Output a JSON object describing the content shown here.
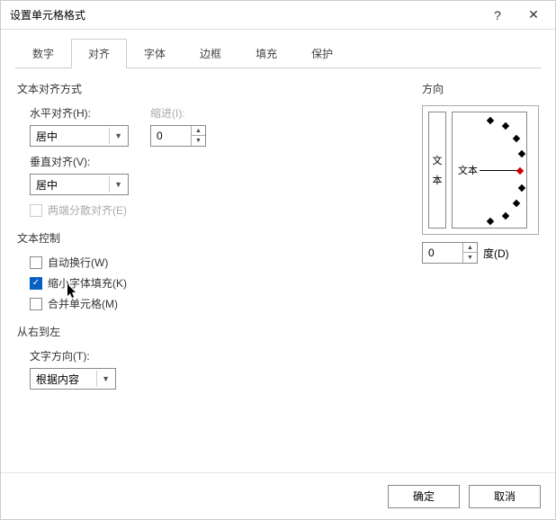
{
  "title": "设置单元格格式",
  "titlebar": {
    "help": "?",
    "close": "✕"
  },
  "tabs": [
    "数字",
    "对齐",
    "字体",
    "边框",
    "填充",
    "保护"
  ],
  "active_tab": 1,
  "align": {
    "group_title": "文本对齐方式",
    "horizontal_label": "水平对齐(H):",
    "horizontal_value": "居中",
    "vertical_label": "垂直对齐(V):",
    "vertical_value": "居中",
    "indent_label": "缩进(I):",
    "indent_value": "0",
    "justify_distributed_label": "两端分散对齐(E)",
    "justify_distributed_checked": false
  },
  "text_control": {
    "group_title": "文本控制",
    "wrap_label": "自动换行(W)",
    "wrap_checked": false,
    "shrink_label": "缩小字体填充(K)",
    "shrink_checked": true,
    "merge_label": "合并单元格(M)",
    "merge_checked": false
  },
  "rtl": {
    "group_title": "从右到左",
    "dir_label": "文字方向(T):",
    "dir_value": "根据内容"
  },
  "orientation": {
    "group_title": "方向",
    "vert_char1": "文",
    "vert_char2": "本",
    "dial_label": "文本",
    "degrees_value": "0",
    "degrees_label": "度(D)"
  },
  "footer": {
    "ok": "确定",
    "cancel": "取消"
  }
}
